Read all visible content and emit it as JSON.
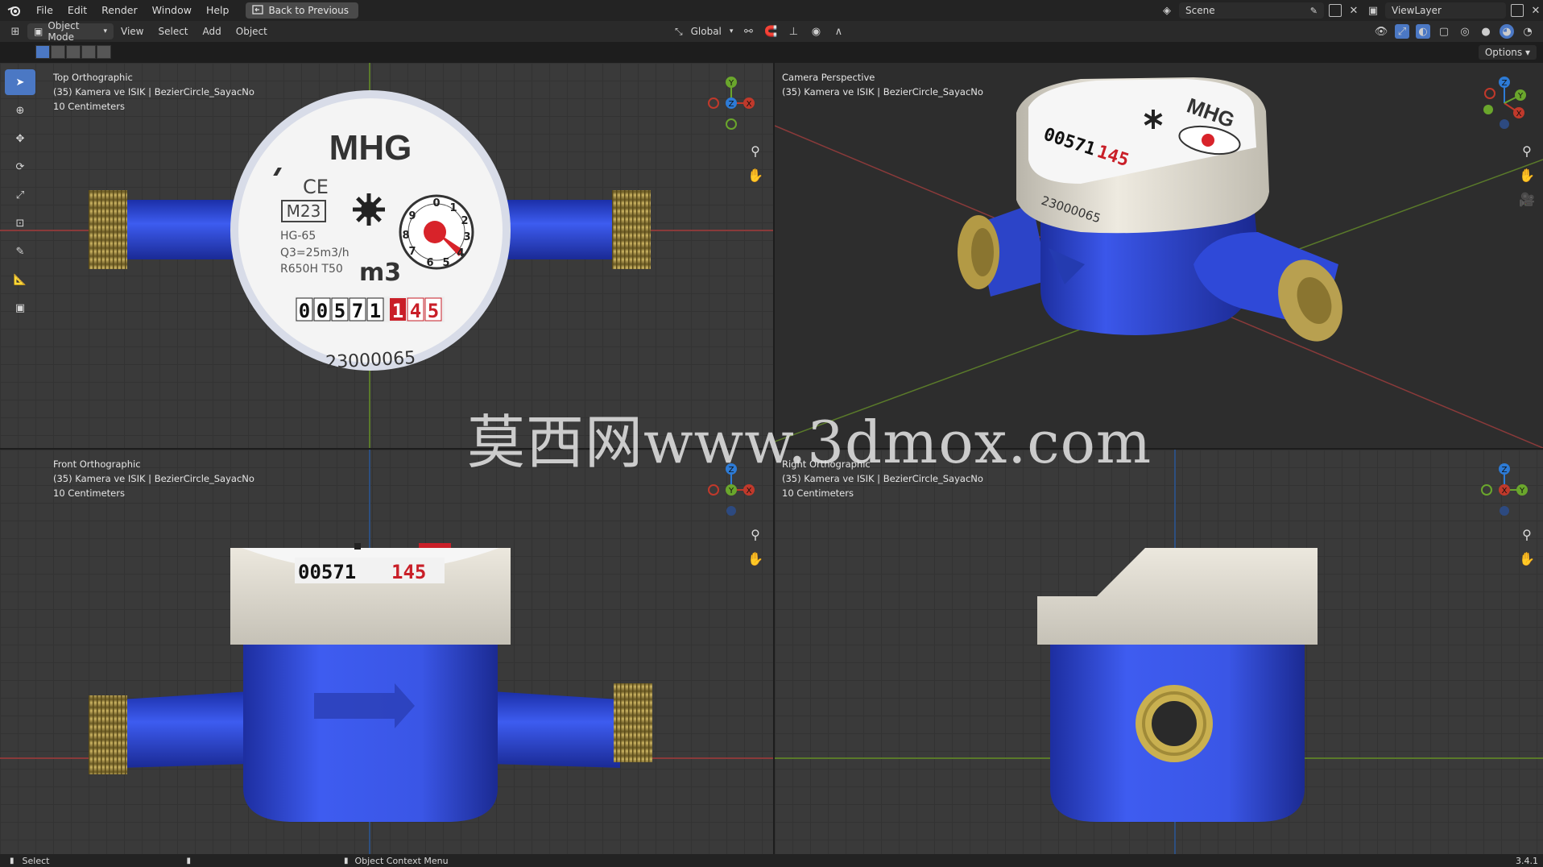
{
  "topbar": {
    "menus": [
      "File",
      "Edit",
      "Render",
      "Window",
      "Help"
    ],
    "back_label": "Back to Previous",
    "scene": "Scene",
    "view_layer": "ViewLayer"
  },
  "header": {
    "mode": "Object Mode",
    "menus": [
      "View",
      "Select",
      "Add",
      "Object"
    ],
    "orientation": "Global",
    "options": "Options"
  },
  "viewports": {
    "top": {
      "name": "Top Orthographic",
      "object": "(35) Kamera ve ISIK | BezierCircle_SayacNo",
      "scale": "10 Centimeters"
    },
    "camera": {
      "name": "Camera Perspective",
      "object": "(35) Kamera ve ISIK | BezierCircle_SayacNo"
    },
    "front": {
      "name": "Front Orthographic",
      "object": "(35) Kamera ve ISIK | BezierCircle_SayacNo",
      "scale": "10 Centimeters"
    },
    "right": {
      "name": "Right Orthographic",
      "object": "(35) Kamera ve ISIK | BezierCircle_SayacNo",
      "scale": "10 Centimeters"
    }
  },
  "meter": {
    "brand": "MHG",
    "ce": "CE",
    "class_mark": "M23",
    "model": "HG-65",
    "q3": "Q3=25m3/h",
    "ratio": "R650H  T50",
    "unit": "m3",
    "digits_black": "00571",
    "digits_red": "145",
    "serial": "23000065",
    "dial": [
      "0",
      "1",
      "2",
      "3",
      "4",
      "5",
      "6",
      "7",
      "8",
      "9"
    ]
  },
  "gizmo_labels": {
    "x": "X",
    "y": "Y",
    "z": "Z"
  },
  "status": {
    "left": "Select",
    "middle": "Object Context Menu",
    "version": "3.4.1"
  },
  "watermark": "莫西网www.3dmox.com",
  "colors": {
    "accent": "#4b78c4",
    "body_blue": "#2f49d8",
    "brass": "#b8a050",
    "cap": "#e4e0d6",
    "x_axis": "#c0392b",
    "y_axis": "#6aa62c",
    "z_axis": "#2d7bd6"
  }
}
